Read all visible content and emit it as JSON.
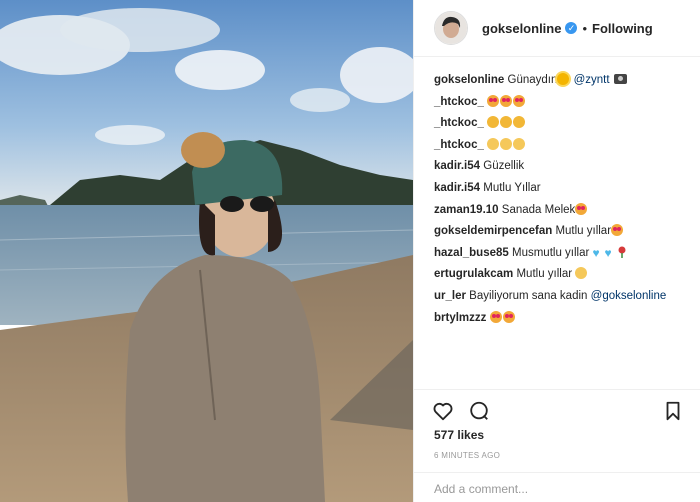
{
  "post": {
    "username": "gokselonline",
    "follow_status": "Following",
    "separator": "•",
    "verified_mark": "✓"
  },
  "comments": [
    {
      "user": "gokselonline",
      "text": "Günaydın",
      "mention": "@zyntt",
      "emojis": [
        "sun-emoji",
        "camera-emoji"
      ]
    },
    {
      "user": "_htckoc_",
      "text": "",
      "emojis": [
        "heart-eyes-emoji",
        "heart-eyes-emoji",
        "heart-eyes-emoji"
      ]
    },
    {
      "user": "_htckoc_",
      "text": "",
      "emojis": [
        "smile-emoji",
        "smile-emoji",
        "smile-emoji"
      ]
    },
    {
      "user": "_htckoc_",
      "text": "",
      "emojis": [
        "grin-emoji",
        "grin-emoji",
        "grin-emoji"
      ]
    },
    {
      "user": "kadir.i54",
      "text": "Güzellik"
    },
    {
      "user": "kadir.i54",
      "text": "Mutlu Yıllar"
    },
    {
      "user": "zaman19.10",
      "text": "Sanada Melek",
      "emojis": [
        "heart-eyes-emoji"
      ]
    },
    {
      "user": "gokseldemirpencefan",
      "text": "Mutlu yıllar",
      "emojis": [
        "heart-eyes-emoji"
      ]
    },
    {
      "user": "hazal_buse85",
      "text": "Musmutlu yıllar",
      "emojis": [
        "blue-heart-emoji",
        "blue-heart-emoji",
        "rose-emoji"
      ]
    },
    {
      "user": "ertugrulakcam",
      "text": "Mutlu yıllar",
      "emojis": [
        "smile-emoji"
      ]
    },
    {
      "user": "ur_ler",
      "text": "Bayiliyorum sana kadin",
      "mention": "@gokselonline"
    },
    {
      "user": "brtylmzzz",
      "text": "",
      "emojis": [
        "heart-eyes-emoji",
        "heart-eyes-emoji"
      ]
    }
  ],
  "stats": {
    "likes": "577 likes",
    "time": "6 MINUTES AGO"
  },
  "comment_box": {
    "placeholder": "Add a comment..."
  },
  "icons": {
    "like": "heart-outline-icon",
    "comment": "comment-bubble-icon",
    "save": "bookmark-icon"
  },
  "colors": {
    "verified": "#3897f0",
    "mention": "#003569",
    "text": "#262626",
    "muted": "#999999"
  }
}
